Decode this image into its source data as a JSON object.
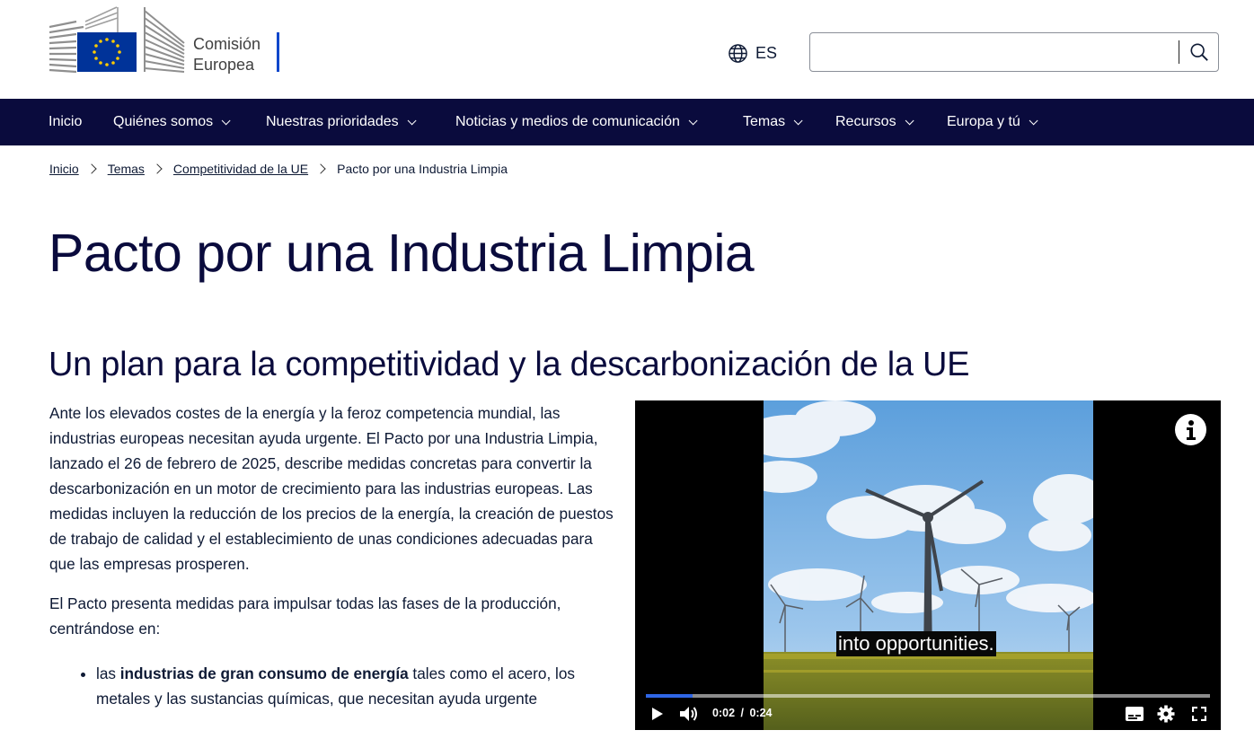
{
  "header": {
    "logo_line1": "Comisión",
    "logo_line2": "Europea",
    "language": "ES",
    "search": {
      "value": "",
      "placeholder": ""
    }
  },
  "nav": {
    "items": [
      {
        "label": "Inicio"
      },
      {
        "label": "Quiénes somos"
      },
      {
        "label": "Nuestras prioridades"
      },
      {
        "label": "Noticias y medios de comunicación"
      },
      {
        "label": "Temas"
      },
      {
        "label": "Recursos"
      },
      {
        "label": "Europa y tú"
      }
    ]
  },
  "breadcrumb": [
    "Inicio",
    "Temas",
    "Competitividad de la UE",
    "Pacto por una Industria Limpia"
  ],
  "page_title": "Pacto por una Industria Limpia",
  "section_title": "Un plan para la competitividad y la descarbonización de la UE",
  "paragraphs": [
    "Ante los elevados costes de la energía y la feroz competencia mundial, las industrias europeas necesitan ayuda urgente. El Pacto por una Industria Limpia, lanzado el 26 de febrero de 2025, describe medidas concretas para convertir la descarbonización en un motor de crecimiento para las industrias europeas. Las medidas incluyen la reducción de los precios de la energía, la creación de puestos de trabajo de calidad y el establecimiento de unas condiciones adecuadas para que las empresas prosperen.",
    "El Pacto presenta medidas para impulsar todas las fases de la producción, centrándose en:"
  ],
  "list_items": [
    {
      "prefix": "las ",
      "bold": "industrias de gran consumo de energía",
      "suffix": " tales como el acero, los metales y las sustancias químicas, que necesitan ayuda urgente"
    }
  ],
  "video": {
    "caption": "into opportunities.",
    "current_time": "0:02",
    "separator": "/",
    "duration": "0:24",
    "progress_fraction": 0.0833
  },
  "colors": {
    "nav_background": "#0a0b3d",
    "eu_blue": "#003399",
    "eu_yellow": "#ffcc00",
    "progress": "#2f66e6"
  }
}
